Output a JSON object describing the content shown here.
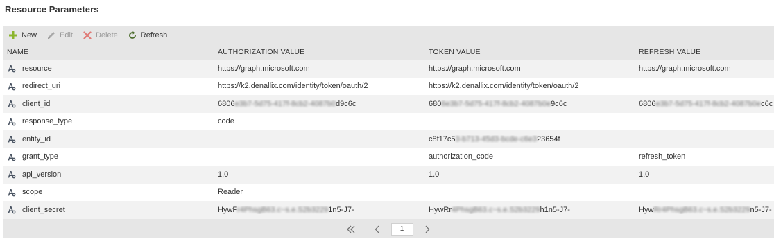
{
  "page": {
    "title": "Resource Parameters"
  },
  "toolbar": {
    "new_label": "New",
    "edit_label": "Edit",
    "delete_label": "Delete",
    "refresh_label": "Refresh"
  },
  "grid": {
    "columns": [
      "NAME",
      "AUTHORIZATION VALUE",
      "TOKEN VALUE",
      "REFRESH VALUE"
    ],
    "rows": [
      {
        "name": "resource",
        "auth": {
          "pre": "https://graph.microsoft.com",
          "mid": "",
          "post": ""
        },
        "token": {
          "pre": "https://graph.microsoft.com",
          "mid": "",
          "post": ""
        },
        "refresh": {
          "pre": "https://graph.microsoft.com",
          "mid": "",
          "post": ""
        }
      },
      {
        "name": "redirect_uri",
        "auth": {
          "pre": "https://k2.denallix.com/identity/token/oauth/2",
          "mid": "",
          "post": ""
        },
        "token": {
          "pre": "https://k2.denallix.com/identity/token/oauth/2",
          "mid": "",
          "post": ""
        },
        "refresh": {
          "pre": "",
          "mid": "",
          "post": ""
        }
      },
      {
        "name": "client_id",
        "auth": {
          "pre": "6806",
          "mid": "e3b7-5d75-417f-8cb2-4087b0",
          "post": "d9c6c"
        },
        "token": {
          "pre": "680",
          "mid": "6e3b7-5d75-417f-8cb2-4087b0e",
          "post": "9c6c"
        },
        "refresh": {
          "pre": "6806",
          "mid": "e3b7-5d75-417f-8cb2-4087b0e",
          "post": "c6c"
        }
      },
      {
        "name": "response_type",
        "auth": {
          "pre": "code",
          "mid": "",
          "post": ""
        },
        "token": {
          "pre": "",
          "mid": "",
          "post": ""
        },
        "refresh": {
          "pre": "",
          "mid": "",
          "post": ""
        }
      },
      {
        "name": "entity_id",
        "auth": {
          "pre": "",
          "mid": "",
          "post": ""
        },
        "token": {
          "pre": "c8f17c5",
          "mid": "3-b713-45d3-bcde-c6e3",
          "post": "23654f"
        },
        "refresh": {
          "pre": "",
          "mid": "",
          "post": ""
        }
      },
      {
        "name": "grant_type",
        "auth": {
          "pre": "",
          "mid": "",
          "post": ""
        },
        "token": {
          "pre": "authorization_code",
          "mid": "",
          "post": ""
        },
        "refresh": {
          "pre": "refresh_token",
          "mid": "",
          "post": ""
        }
      },
      {
        "name": "api_version",
        "auth": {
          "pre": "1.0",
          "mid": "",
          "post": ""
        },
        "token": {
          "pre": "1.0",
          "mid": "",
          "post": ""
        },
        "refresh": {
          "pre": "1.0",
          "mid": "",
          "post": ""
        }
      },
      {
        "name": "scope",
        "auth": {
          "pre": "Reader",
          "mid": "",
          "post": ""
        },
        "token": {
          "pre": "",
          "mid": "",
          "post": ""
        },
        "refresh": {
          "pre": "",
          "mid": "",
          "post": ""
        }
      },
      {
        "name": "client_secret",
        "auth": {
          "pre": "HywF",
          "mid": "r4PhsgB63.c~s.e.S2b3229",
          "post": "1n5-J7-"
        },
        "token": {
          "pre": "HywRr",
          "mid": "4PhsgB63.c~s.e.S2b3229",
          "post": "h1n5-J7-"
        },
        "refresh": {
          "pre": "Hyw",
          "mid": "Rr4PhsgB63.c~s.e.S2b3229",
          "post": "n5-J7-"
        }
      }
    ]
  },
  "pager": {
    "current_page": "1"
  },
  "colors": {
    "new_icon": "#8bb52c",
    "delete_icon": "#d9534f",
    "disabled_text": "#9a9a9a",
    "header_bg": "#e6e6e6",
    "row_alt_bg": "#f2f2f2"
  },
  "icons": {
    "new": "plus-icon",
    "edit": "pencil-icon",
    "delete": "x-icon",
    "refresh": "refresh-icon",
    "row": "parameter-icon",
    "pager_first": "double-chevron-left-icon",
    "pager_prev": "chevron-left-icon",
    "pager_next": "chevron-right-icon"
  }
}
